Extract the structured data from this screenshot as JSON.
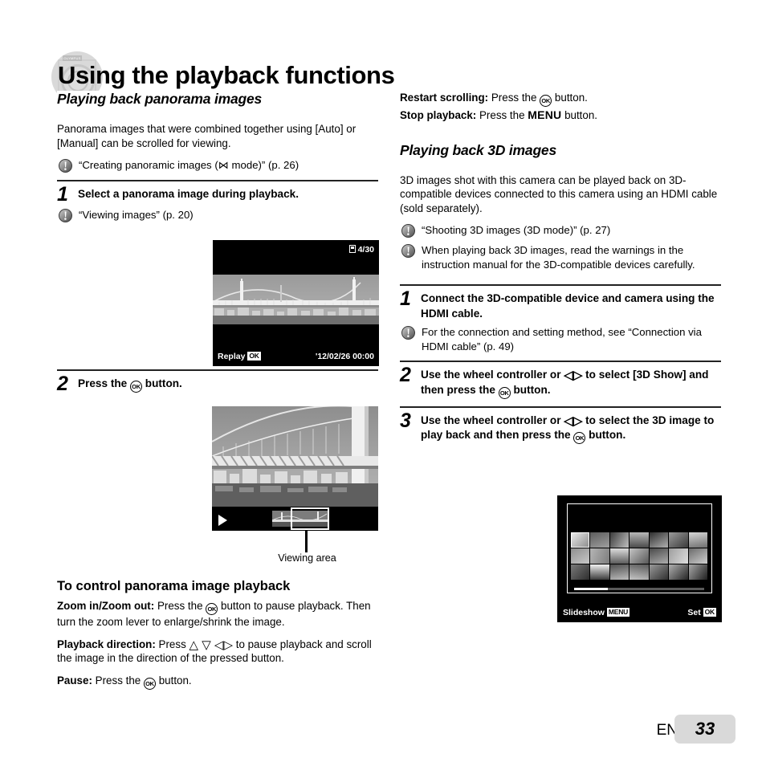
{
  "page": {
    "title": "Using the playback functions",
    "watermark_brand": "OLYMPUS",
    "footer_lang": "EN",
    "footer_page": "33"
  },
  "left_column": {
    "section_heading": "Playing back panorama images",
    "intro": "Panorama images that were combined together using [Auto] or [Manual] can be scrolled for viewing.",
    "intro_note": "“Creating panoramic images (⋈ mode)” (p. 26)",
    "step1": {
      "number": "1",
      "text": "Select a panorama image during playback.",
      "note": "“Viewing images” (p. 20)"
    },
    "camera_screen_1": {
      "counter": "4/30",
      "action_label": "Replay",
      "action_badge": "OK",
      "datetime": "'12/02/26  00:00"
    },
    "step2": {
      "number": "2",
      "text_before": "Press the",
      "button_badge": "OK",
      "text_after": "button."
    },
    "camera_screen_2": {
      "callout": "Viewing area"
    },
    "control_heading": "To control panorama image playback",
    "controls": [
      {
        "label": "Zoom in/Zoom out:",
        "text_before": "Press the",
        "button_badge": "OK",
        "text_after": "button to pause playback. Then turn the zoom lever to enlarge/shrink the image."
      },
      {
        "label": "Playback direction:",
        "text_before": "Press",
        "arrows": "△ ▽ ◁▷",
        "text_after": "to pause playback and scroll the image in the direction of the pressed button."
      },
      {
        "label": "Pause:",
        "text_before": "Press the",
        "button_badge": "OK",
        "text_after": "button."
      }
    ]
  },
  "right_column": {
    "top_controls": [
      {
        "label": "Restart scrolling:",
        "text_before": "Press the",
        "button_badge": "OK",
        "text_after": "button."
      },
      {
        "label": "Stop playback:",
        "text_before": "Press the",
        "menu_word": "MENU",
        "text_after": "button."
      }
    ],
    "section_heading": "Playing back 3D images",
    "intro": "3D images shot with this camera can be played back on 3D-compatible devices connected to this camera using an HDMI cable (sold separately).",
    "notes": [
      "“Shooting 3D images (3D mode)” (p. 27)",
      "When playing back 3D images, read the warnings in the instruction manual for the 3D-compatible devices carefully."
    ],
    "step1": {
      "number": "1",
      "text": "Connect the 3D-compatible device and camera using the HDMI cable.",
      "note": "For the connection and setting method, see “Connection via HDMI cable” (p. 49)"
    },
    "step2": {
      "number": "2",
      "text_a": "Use the wheel controller or",
      "arrows": "◁▷",
      "text_b": "to select [3D Show] and then press the",
      "button_badge": "OK",
      "text_c": "button."
    },
    "step3": {
      "number": "3",
      "text_a": "Use the wheel controller or",
      "arrows": "◁▷",
      "text_b": "to select the 3D image to play back and then press the",
      "button_badge": "OK",
      "text_c": "button."
    },
    "camera_screen_3": {
      "left_label": "Slideshow",
      "left_badge": "MENU",
      "right_label": "Set",
      "right_badge": "OK",
      "thumbnail_rows": 3,
      "thumbnail_cols": 7,
      "selected_index": 0
    }
  },
  "colors": {
    "heading_underline": "#d0d0d0",
    "rule": "#222222",
    "screen_bg": "#000000",
    "footer_badge": "#d9d9d9"
  }
}
